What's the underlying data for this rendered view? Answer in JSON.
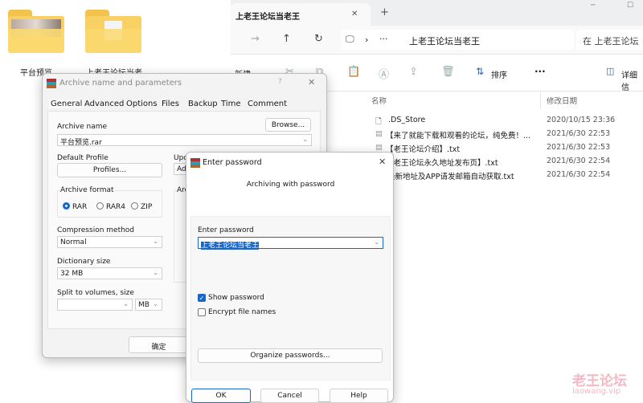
{
  "desktop": {
    "items": [
      {
        "label": "平台预览",
        "icon": "folder-with-image-icon"
      },
      {
        "label": "上老王论坛当老",
        "icon": "folder-icon"
      }
    ]
  },
  "explorer": {
    "tab_title": "上老王论坛当老王",
    "new_tab": "+",
    "breadcrumb": "上老王论坛当老王",
    "breadcrumb_more": "···",
    "search_placeholder": "在 上老王论坛",
    "toolbar": {
      "new_label": "新建",
      "sort_label": "排序",
      "more": "···",
      "details_label": "详细信"
    },
    "columns": {
      "name": "名称",
      "date": "修改日期"
    },
    "files": [
      {
        "name": ".DS_Store",
        "date": "2020/10/15 23:36"
      },
      {
        "name": "【来了就能下载和观看的论坛，纯免费！...",
        "date": "2021/6/30 22:53"
      },
      {
        "name": "【老王论坛介绍】.txt",
        "date": "2021/6/30 22:53"
      },
      {
        "name": "【老王论坛永久地址发布页】.txt",
        "date": "2021/6/30 22:54"
      },
      {
        "name": "获取最新地址及APP请发邮箱自动获取.txt",
        "date": "2021/6/30 22:54"
      }
    ]
  },
  "archive_dialog": {
    "title": "Archive name and parameters",
    "help": "?",
    "close": "✕",
    "tabs": [
      "General",
      "Advanced",
      "Options",
      "Files",
      "Backup",
      "Time",
      "Comment"
    ],
    "archive_name_label": "Archive name",
    "browse": "Browse...",
    "archive_name": "平台预览.rar",
    "default_profile_label": "Default Profile",
    "profiles": "Profiles...",
    "update_label": "Upd",
    "update_value": "Add",
    "archive_format_label": "Archive format",
    "formats": [
      "RAR",
      "RAR4",
      "ZIP"
    ],
    "selected_format": "RAR",
    "options_label": "Arc",
    "compression_label": "Compression method",
    "compression": "Normal",
    "dictionary_label": "Dictionary size",
    "dictionary": "32 MB",
    "split_label": "Split to volumes, size",
    "split_value": "",
    "split_unit": "MB",
    "ok": "确定"
  },
  "password_dialog": {
    "title": "Enter password",
    "close": "✕",
    "heading": "Archiving with password",
    "enter_label": "Enter password",
    "password": "上老王论坛当老王",
    "show_password": "Show password",
    "show_password_checked": true,
    "encrypt_names": "Encrypt file names",
    "encrypt_names_checked": false,
    "organize": "Organize passwords...",
    "ok": "OK",
    "cancel": "Cancel",
    "help": "Help"
  },
  "watermark": {
    "text": "老王论坛",
    "url": "laowang.vip",
    "color": "#f4b8c4"
  }
}
